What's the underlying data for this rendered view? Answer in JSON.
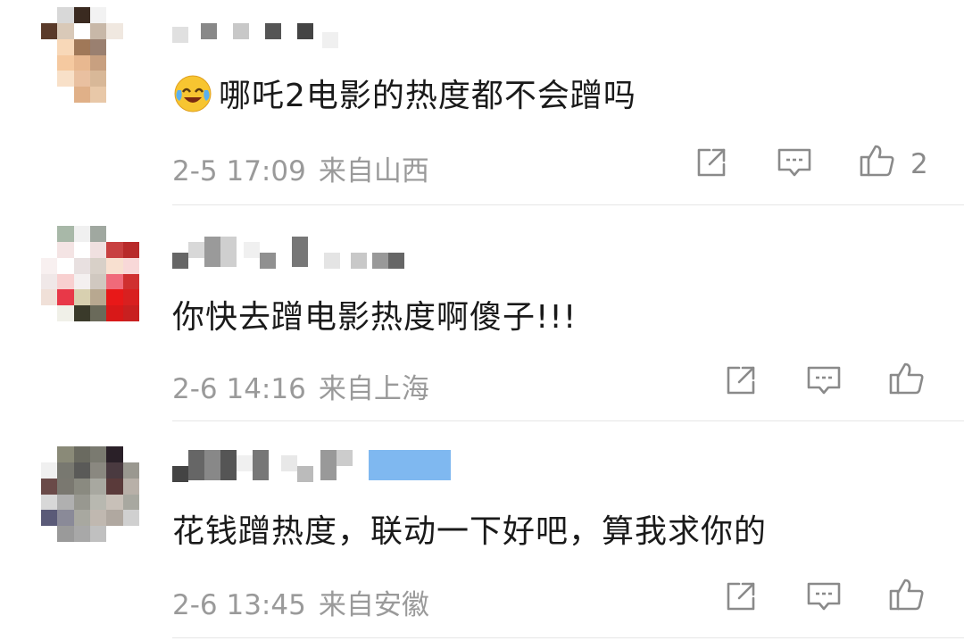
{
  "comments": [
    {
      "text": "哪吒2电影的热度都不会蹭吗",
      "time": "2-5 17:09",
      "location": "来自山西",
      "likes": "2",
      "has_emoji": true
    },
    {
      "text": "你快去蹭电影热度啊傻子!!!",
      "time": "2-6 14:16",
      "location": "来自上海",
      "likes": ""
    },
    {
      "text": "花钱蹭热度，联动一下好吧，算我求你的",
      "time": "2-6 13:45",
      "location": "来自安徽",
      "likes": ""
    }
  ],
  "icons": {
    "share": "share-icon",
    "comment": "comment-icon",
    "like": "like-icon",
    "emoji": "laughing-crying-emoji-icon"
  },
  "colors": {
    "text": "#1a1a1a",
    "meta": "#9a9a9a",
    "icon": "#8a8a8a",
    "verified_badge": "#7fb8f0"
  }
}
